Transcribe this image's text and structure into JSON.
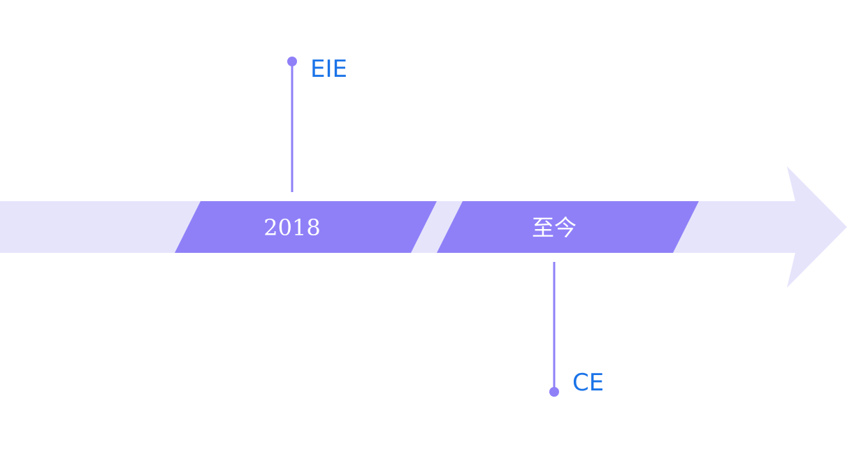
{
  "timeline": {
    "colors": {
      "track": "#e6e4fb",
      "segment": "#8f80f8",
      "connector": "#8f80f8",
      "event_text": "#1a73e8",
      "segment_text": "#ffffff"
    },
    "segments": [
      {
        "label": "2018"
      },
      {
        "label": "至今"
      }
    ],
    "events": [
      {
        "label": "EIE",
        "side": "above",
        "segment": 0
      },
      {
        "label": "CE",
        "side": "below",
        "segment": 1
      }
    ]
  }
}
